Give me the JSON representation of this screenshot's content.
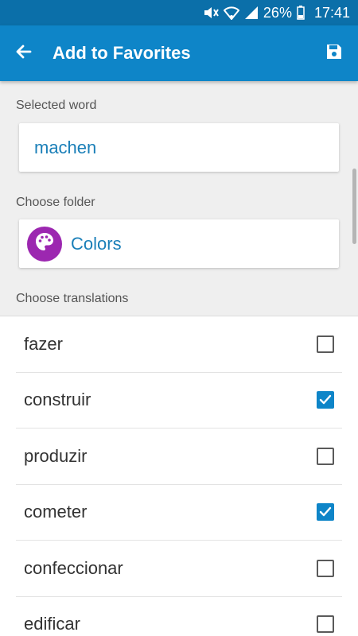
{
  "status_bar": {
    "battery": "26%",
    "time": "17:41",
    "icons": [
      "mute-icon",
      "wifi-icon",
      "signal-icon",
      "battery-icon"
    ]
  },
  "app_bar": {
    "title": "Add to Favorites",
    "back_icon": "arrow-left-icon",
    "save_icon": "floppy-disk-icon"
  },
  "selected_word": {
    "label": "Selected word",
    "value": "machen"
  },
  "folder": {
    "label": "Choose folder",
    "name": "Colors",
    "icon": "palette-icon",
    "avatar_color": "#9c27b0"
  },
  "translations": {
    "label": "Choose translations",
    "items": [
      {
        "text": "fazer",
        "checked": false
      },
      {
        "text": "construir",
        "checked": true
      },
      {
        "text": "produzir",
        "checked": false
      },
      {
        "text": "cometer",
        "checked": true
      },
      {
        "text": "confeccionar",
        "checked": false
      },
      {
        "text": "edificar",
        "checked": false
      }
    ]
  },
  "colors": {
    "accent": "#0e85c8",
    "status_bar": "#0b6fa9"
  }
}
